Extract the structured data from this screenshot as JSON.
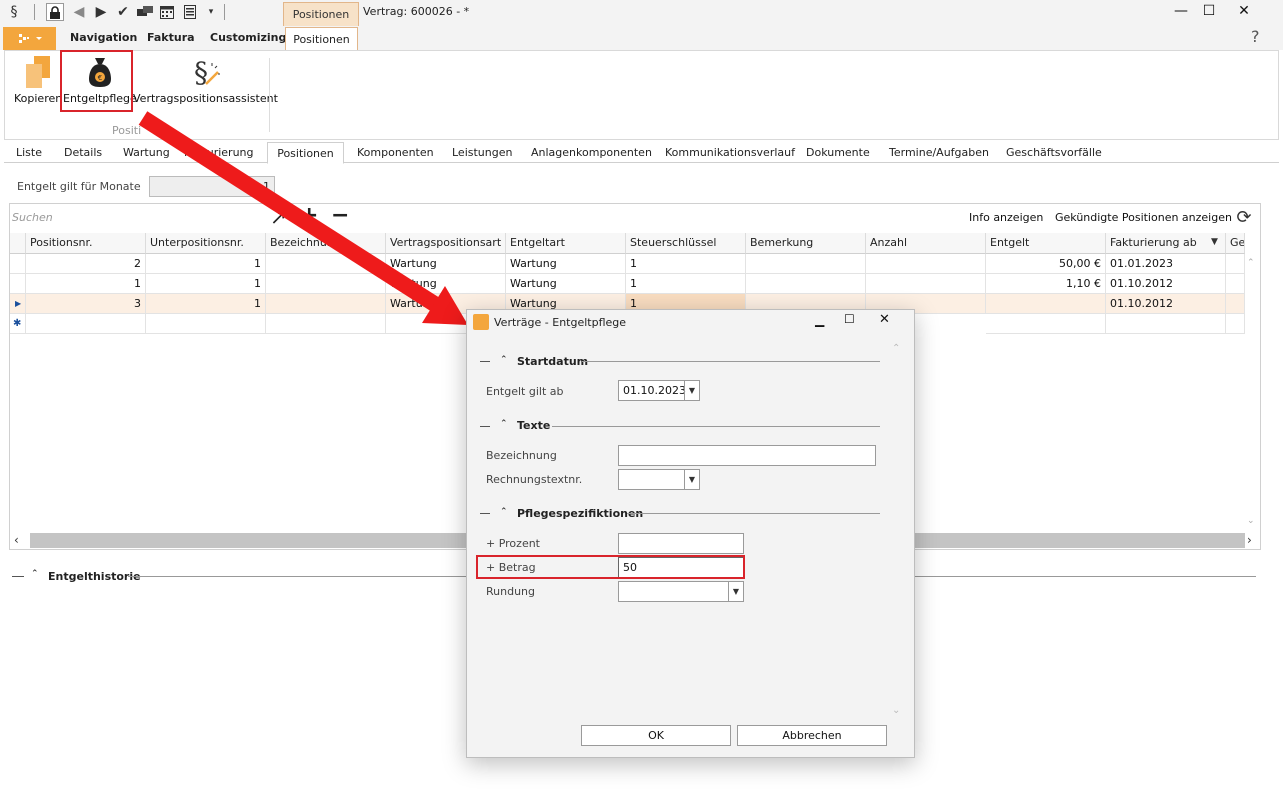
{
  "titlebar": {
    "section_icon": "§",
    "context_tab": "Positionen",
    "doc_title": "Vertrag: 600026 - *",
    "minimize": "—",
    "maximize": "☐",
    "close": "✕"
  },
  "ribbon_tabs": {
    "navigation": "Navigation",
    "faktura": "Faktura",
    "customizing": "Customizing",
    "positionen": "Positionen",
    "help": "?"
  },
  "ribbon": {
    "kopieren": "Kopieren",
    "entgeltpflege": "Entgeltpflege",
    "assistent": "Vertragspositionsassistent",
    "group_label": "Positi"
  },
  "content_tabs": [
    "Liste",
    "Details",
    "Wartung",
    "Fakturierung",
    "Positionen",
    "Komponenten",
    "Leistungen",
    "Anlagenkomponenten",
    "Kommunikationsverlauf",
    "Dokumente",
    "Termine/Aufgaben",
    "Geschäftsvorfälle"
  ],
  "months": {
    "label": "Entgelt gilt für Monate",
    "value": "1"
  },
  "grid": {
    "search_placeholder": "Suchen",
    "info_link": "Info anzeigen",
    "kuend_link": "Gekündigte Positionen anzeigen",
    "columns": [
      "Positionsnr.",
      "Unterpositionsnr.",
      "Bezeichnung",
      "Vertragspositionsart",
      "Entgeltart",
      "Steuerschlüssel",
      "Bemerkung",
      "Anzahl",
      "Entgelt",
      "Fakturierung ab",
      "Ge"
    ],
    "rows": [
      [
        "2",
        "1",
        "",
        "Wartung",
        "Wartung",
        "1",
        "",
        "",
        "50,00 €",
        "01.01.2023"
      ],
      [
        "1",
        "1",
        "",
        "Wartung",
        "Wartung",
        "1",
        "",
        "",
        "1,10 €",
        "01.10.2012"
      ],
      [
        "3",
        "1",
        "",
        "Wartung",
        "Wartung",
        "1",
        "",
        "",
        "",
        "01.10.2012"
      ]
    ]
  },
  "historie": {
    "label": "Entgelthistorie"
  },
  "dialog": {
    "title": "Verträge - Entgeltpflege",
    "sec_startdatum": "Startdatum",
    "entgelt_ab_label": "Entgelt gilt ab",
    "entgelt_ab_value": "01.10.2023",
    "sec_texte": "Texte",
    "bezeichnung_label": "Bezeichnung",
    "bezeichnung_value": "",
    "rechnungstext_label": "Rechnungstextnr.",
    "rechnungstext_value": "",
    "sec_pflege": "Pflegespezifiktionen",
    "prozent_label": "+ Prozent",
    "prozent_value": "",
    "betrag_label": "+ Betrag",
    "betrag_value": "50",
    "rundung_label": "Rundung",
    "rundung_value": "",
    "ok": "OK",
    "cancel": "Abbrechen"
  },
  "colors": {
    "accent": "#f3a63d",
    "highlight": "#d9242b",
    "selected_row": "#fcefe3"
  }
}
